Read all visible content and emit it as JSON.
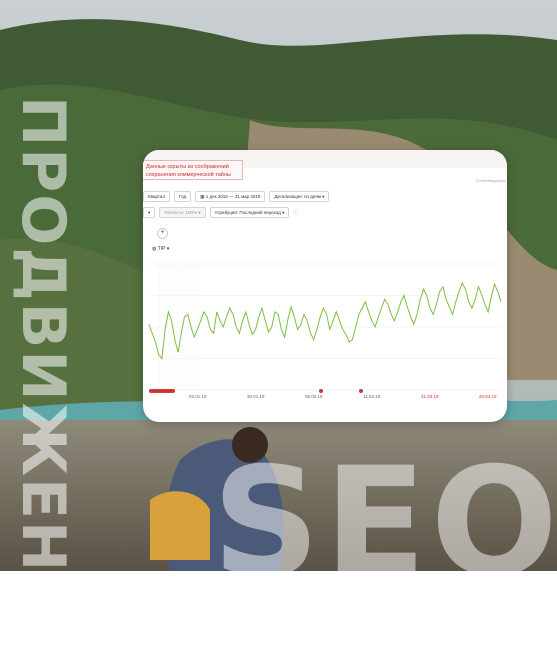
{
  "background": {
    "vertical_text": "ПРОДВИЖЕНИЕ",
    "big_text": "SEO"
  },
  "panel": {
    "notice_line1": "Данные скрыты из соображений",
    "notice_line2": "сохранения коммерческой тайны",
    "report_link": "Отчёт/выгрузка",
    "period_buttons": [
      "Квартал",
      "Год"
    ],
    "date_range": "1 дек 2018 — 31 мар 2019",
    "detail": "Детализация: по дням",
    "filter_precision": "Точность: 100%",
    "attribution": "Атрибуция: Последний переход",
    "metric_label": "TIP"
  },
  "chart_data": {
    "type": "line",
    "color": "#7cc041",
    "x_ticks": [
      "03.01.19",
      "30.01.19",
      "05.02.19",
      "11.03.19",
      "31.03.19",
      "20.04.19"
    ],
    "red_ticks": [
      "31.03.19",
      "20.04.19"
    ],
    "values": [
      52,
      45,
      38,
      28,
      25,
      48,
      62,
      55,
      40,
      30,
      45,
      58,
      60,
      50,
      42,
      48,
      55,
      62,
      58,
      48,
      45,
      62,
      55,
      50,
      58,
      65,
      60,
      50,
      45,
      55,
      62,
      52,
      44,
      48,
      58,
      65,
      55,
      46,
      50,
      62,
      60,
      48,
      42,
      56,
      66,
      58,
      48,
      52,
      60,
      55,
      45,
      40,
      48,
      58,
      65,
      60,
      48,
      55,
      62,
      55,
      48,
      44,
      38,
      40,
      50,
      60,
      65,
      70,
      62,
      55,
      50,
      58,
      65,
      72,
      68,
      60,
      55,
      62,
      70,
      75,
      66,
      58,
      52,
      60,
      72,
      80,
      75,
      65,
      60,
      68,
      78,
      82,
      72,
      66,
      60,
      70,
      78,
      85,
      80,
      70,
      65,
      72,
      82,
      76,
      68,
      62,
      74,
      84,
      78,
      70
    ],
    "ylim": [
      0,
      100
    ]
  }
}
